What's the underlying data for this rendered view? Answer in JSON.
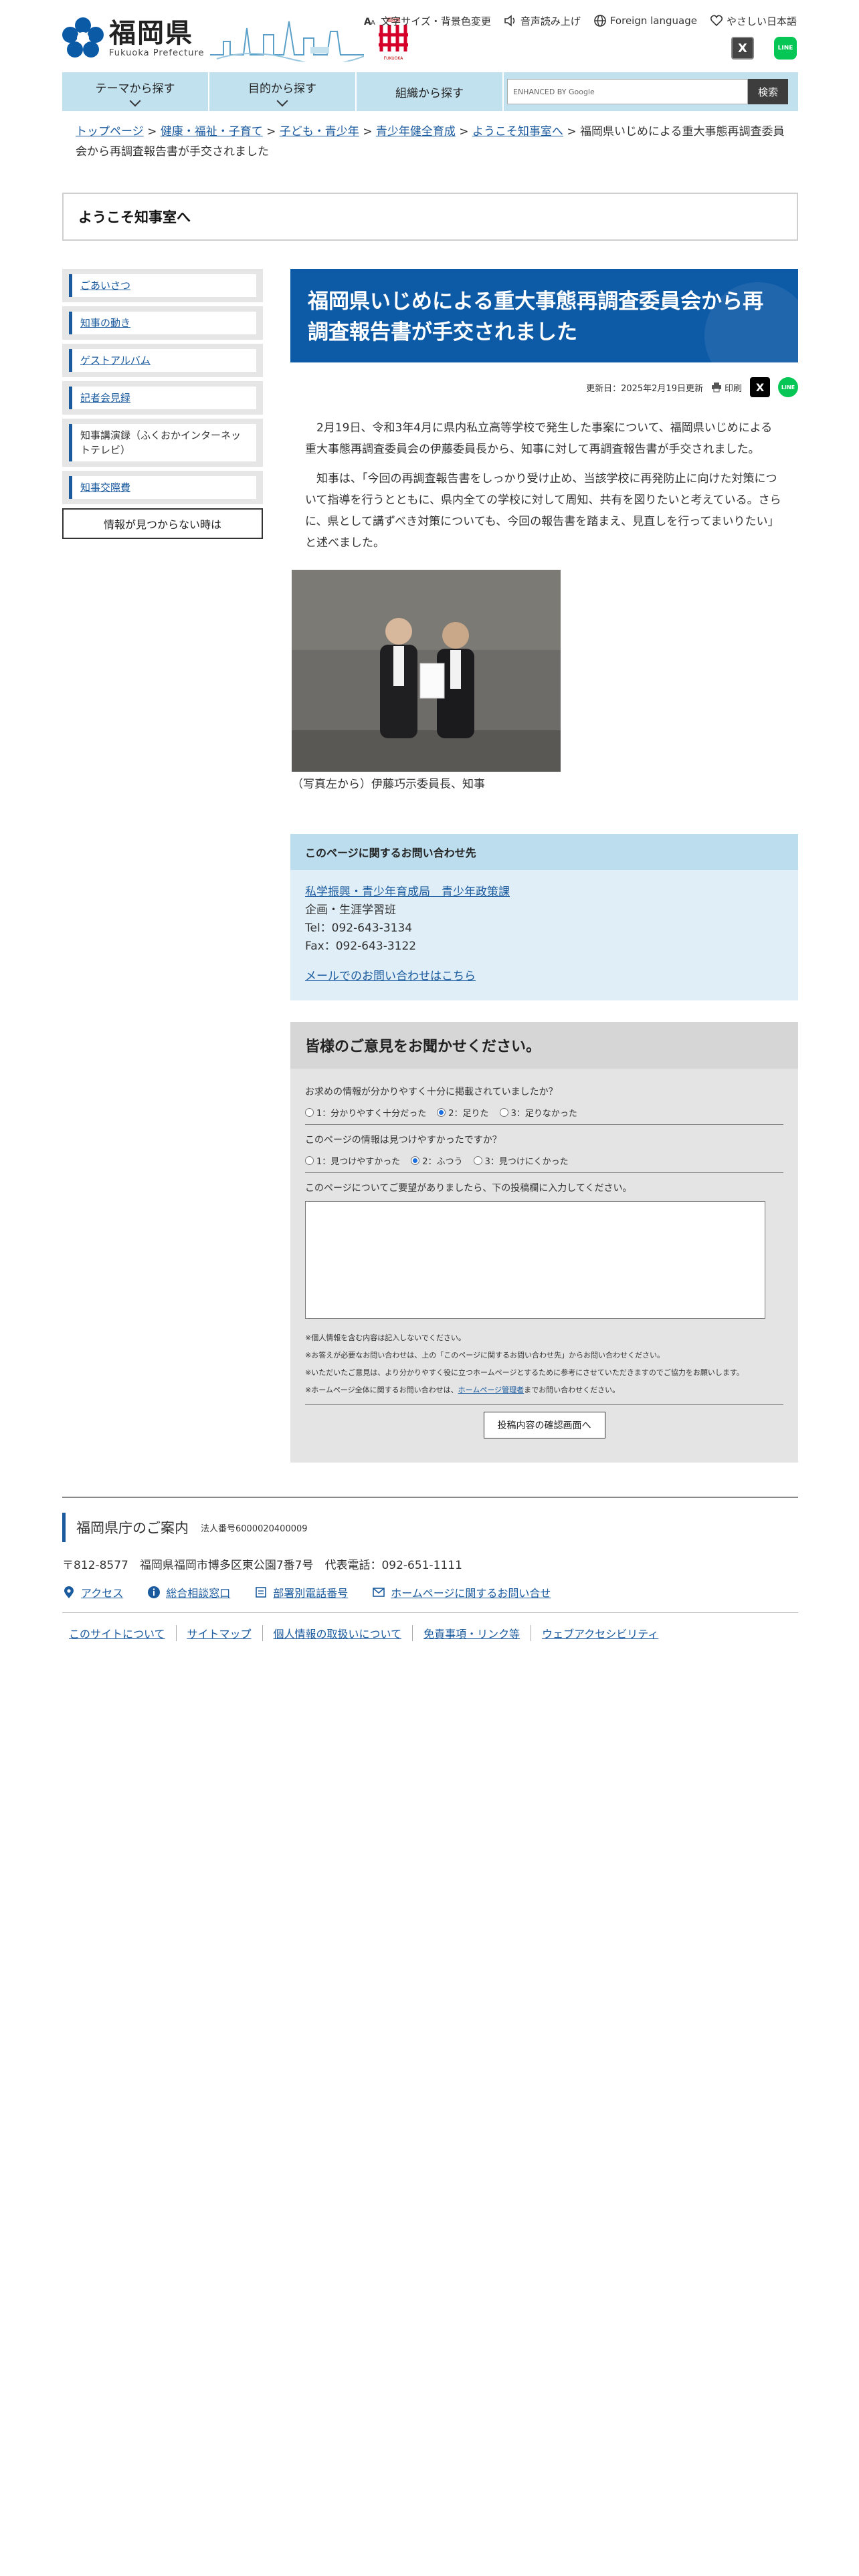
{
  "header": {
    "logo_jp": "福岡県",
    "logo_en": "Fukuoka Prefecture",
    "util": [
      {
        "label": "文字サイズ・背景色変更",
        "icon": "text-size-icon"
      },
      {
        "label": "音声読み上げ",
        "icon": "speaker-icon"
      },
      {
        "label": "Foreign language",
        "icon": "globe-icon"
      },
      {
        "label": "やさしい日本語",
        "icon": "heart-icon"
      }
    ],
    "sns": {
      "x": "X",
      "line": "LINE"
    }
  },
  "nav": {
    "items": [
      "テーマから探す",
      "目的から探す",
      "組織から探す"
    ],
    "search_placeholder": "ENHANCED BY Google",
    "search_button": "検索"
  },
  "breadcrumb": {
    "links": [
      "トップページ",
      "健康・福祉・子育て",
      "子ども・青少年",
      "青少年健全育成",
      "ようこそ知事室へ"
    ],
    "sep": ">",
    "current": "福岡県いじめによる重大事態再調査委員会から再調査報告書が手交されました"
  },
  "section_title": "ようこそ知事室へ",
  "side": {
    "items": [
      {
        "label": "ごあいさつ",
        "link": true
      },
      {
        "label": "知事の動き",
        "link": true
      },
      {
        "label": "ゲストアルバム",
        "link": true
      },
      {
        "label": "記者会見録",
        "link": true
      },
      {
        "label": "知事講演録（ふくおかインターネットテレビ）",
        "link": false
      },
      {
        "label": "知事交際費",
        "link": true
      }
    ],
    "notfound": "情報が見つからない時は"
  },
  "article": {
    "title": "福岡県いじめによる重大事態再調査委員会から再調査報告書が手交されました",
    "updated": "更新日：2025年2月19日更新",
    "print": "印刷",
    "p1": "2月19日、令和3年4月に県内私立高等学校で発生した事案について、福岡県いじめによる重大事態再調査委員会の伊藤委員長から、知事に対して再調査報告書が手交されました。",
    "p2": "知事は、「今回の再調査報告書をしっかり受け止め、当該学校に再発防止に向けた対策について指導を行うとともに、県内全ての学校に対して周知、共有を図りたいと考えている。さらに、県として講ずべき対策についても、今回の報告書を踏まえ、見直しを行ってまいりたい」と述べました。",
    "caption": "（写真左から）伊藤巧示委員長、知事"
  },
  "contact": {
    "heading": "このページに関するお問い合わせ先",
    "dept_link": "私学振興・青少年育成局　青少年政策課",
    "section": "企画・生涯学習班",
    "tel": "Tel：092-643-3134",
    "fax": "Fax：092-643-3122",
    "mail_link": "メールでのお問い合わせはこちら"
  },
  "survey": {
    "heading": "皆様のご意見をお聞かせください。",
    "q1": "お求めの情報が分かりやすく十分に掲載されていましたか？",
    "q1_opts": [
      "1：分かりやすく十分だった",
      "2：足りた",
      "3：足りなかった"
    ],
    "q1_selected": 1,
    "q2": "このページの情報は見つけやすかったですか？",
    "q2_opts": [
      "1：見つけやすかった",
      "2：ふつう",
      "3：見つけにくかった"
    ],
    "q2_selected": 1,
    "q3": "このページについてご要望がありましたら、下の投稿欄に入力してください。",
    "note1": "※個人情報を含む内容は記入しないでください。",
    "note2": "※お答えが必要なお問い合わせは、上の「このページに関するお問い合わせ先」からお問い合わせください。",
    "note3": "※いただいたご意見は、より分かりやすく役に立つホームページとするために参考にさせていただきますのでご協力をお願いします。",
    "note4_pre": "※ホームページ全体に関するお問い合わせは、",
    "note4_link": "ホームページ管理者",
    "note4_post": "までお問い合わせください。",
    "submit": "投稿内容の確認画面へ"
  },
  "footer": {
    "title": "福岡県庁のご案内",
    "corp_no": "法人番号6000020400009",
    "address": "〒812-8577　福岡県福岡市博多区東公園7番7号　代表電話：092-651-1111",
    "links": [
      {
        "label": "アクセス",
        "icon": "map-pin-icon"
      },
      {
        "label": "総合相談窓口",
        "icon": "info-icon"
      },
      {
        "label": "部署別電話番号",
        "icon": "phone-book-icon"
      },
      {
        "label": "ホームページに関するお問い合せ",
        "icon": "mail-icon"
      }
    ],
    "bottom": [
      "このサイトについて",
      "サイトマップ",
      "個人情報の取扱いについて",
      "免責事項・リンク等",
      "ウェブアクセシビリティ"
    ]
  },
  "colors": {
    "brand": "#0d5aa7",
    "nav_bg": "#c2e1ef",
    "contact_bg": "#dfeef7",
    "survey_bg": "#e4e4e4"
  }
}
